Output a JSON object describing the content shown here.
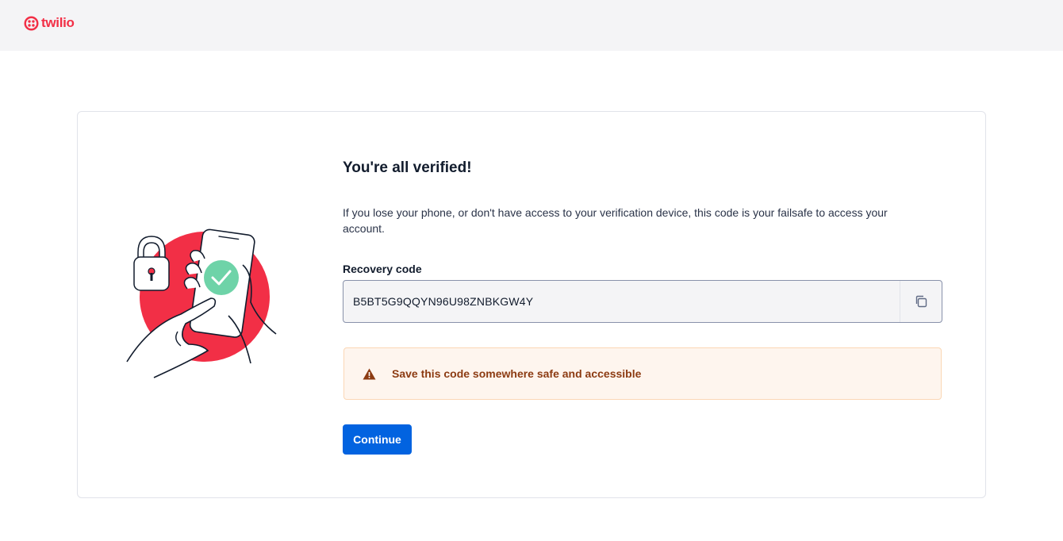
{
  "header": {
    "brand": "twilio",
    "logo_icon": "twilio-logo-icon"
  },
  "main": {
    "title": "You're all verified!",
    "description": "If you lose your phone, or don't have access to your verification device, this code is your failsafe to access your account.",
    "recovery_label": "Recovery code",
    "recovery_code": "B5BT5G9QQYN96U98ZNBKGW4Y",
    "copy_icon": "copy-icon",
    "warning_icon": "warning-triangle-icon",
    "warning_text": "Save this code somewhere safe and accessible",
    "continue_label": "Continue"
  },
  "colors": {
    "brand": "#f22f46",
    "primary_button": "#0263e0",
    "warning_bg": "#fef5ee",
    "warning_text": "#8c3b12",
    "check_green": "#6ed3a8"
  }
}
